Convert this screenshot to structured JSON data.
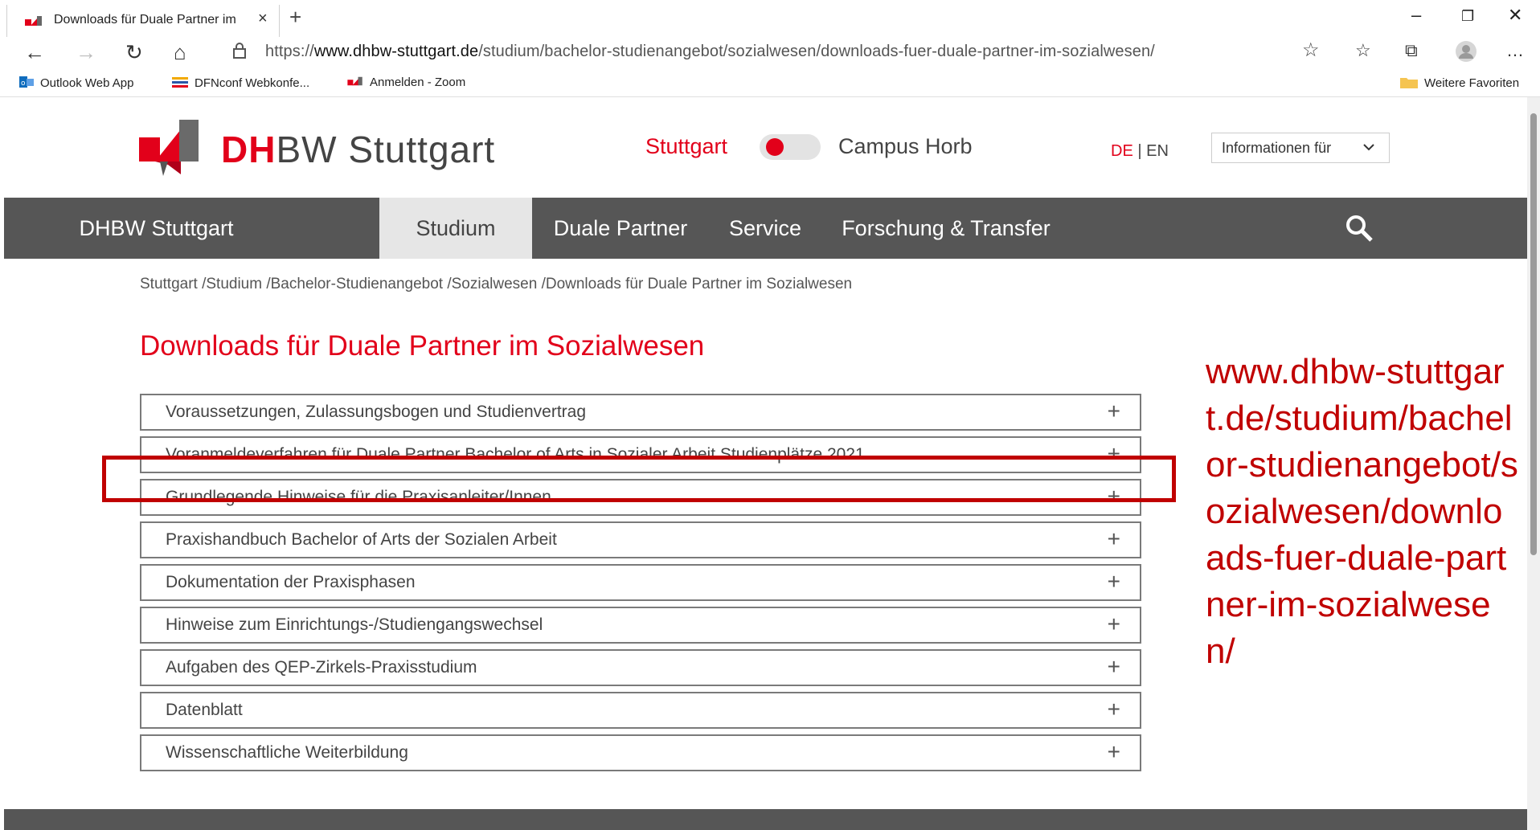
{
  "browser": {
    "tab_title": "Downloads für Duale Partner im",
    "url_prefix": "https://",
    "url_domain": "www.dhbw-stuttgart.de",
    "url_path": "/studium/bachelor-studienangebot/sozialwesen/downloads-fuer-duale-partner-im-sozialwesen/",
    "favorites": [
      "Outlook Web App",
      "DFNconf Webkonfe...",
      "Anmelden - Zoom"
    ],
    "more_favorites": "Weitere Favoriten"
  },
  "header": {
    "logo_dh": "DH",
    "logo_rest": "BW Stuttgart",
    "campus_left": "Stuttgart",
    "campus_right": "Campus Horb",
    "lang_de": "DE",
    "lang_sep": " | ",
    "lang_en": "EN",
    "info_dropdown": "Informationen für"
  },
  "nav": {
    "items": [
      "DHBW Stuttgart",
      "Studium",
      "Duale Partner",
      "Service",
      "Forschung & Transfer"
    ],
    "active": "Studium"
  },
  "breadcrumb": "Stuttgart /Studium /Bachelor-Studienangebot /Sozialwesen /Downloads für Duale Partner im Sozialwesen",
  "page_title": "Downloads für Duale Partner im Sozialwesen",
  "accordion": [
    "Voraussetzungen, Zulassungsbogen und Studienvertrag",
    "Voranmeldeverfahren für Duale Partner Bachelor of Arts in Sozialer Arbeit Studienplätze 2021",
    "Grundlegende Hinweise für die Praxisanleiter/Innen",
    "Praxishandbuch Bachelor of Arts der Sozialen Arbeit",
    "Dokumentation der Praxisphasen",
    "Hinweise zum Einrichtungs-/Studiengangswechsel",
    "Aufgaben des QEP-Zirkels-Praxisstudium",
    "Datenblatt",
    "Wissenschaftliche Weiterbildung"
  ],
  "plus_symbol": "+",
  "annotation_url": "www.dhbw-stuttgart.de/studium/bachelor-studienangebot/sozialwesen/downloads-fuer-duale-partner-im-sozialwesen/",
  "colors": {
    "brand_red": "#e2001a",
    "nav_bg": "#565656",
    "highlight": "#c00000"
  }
}
